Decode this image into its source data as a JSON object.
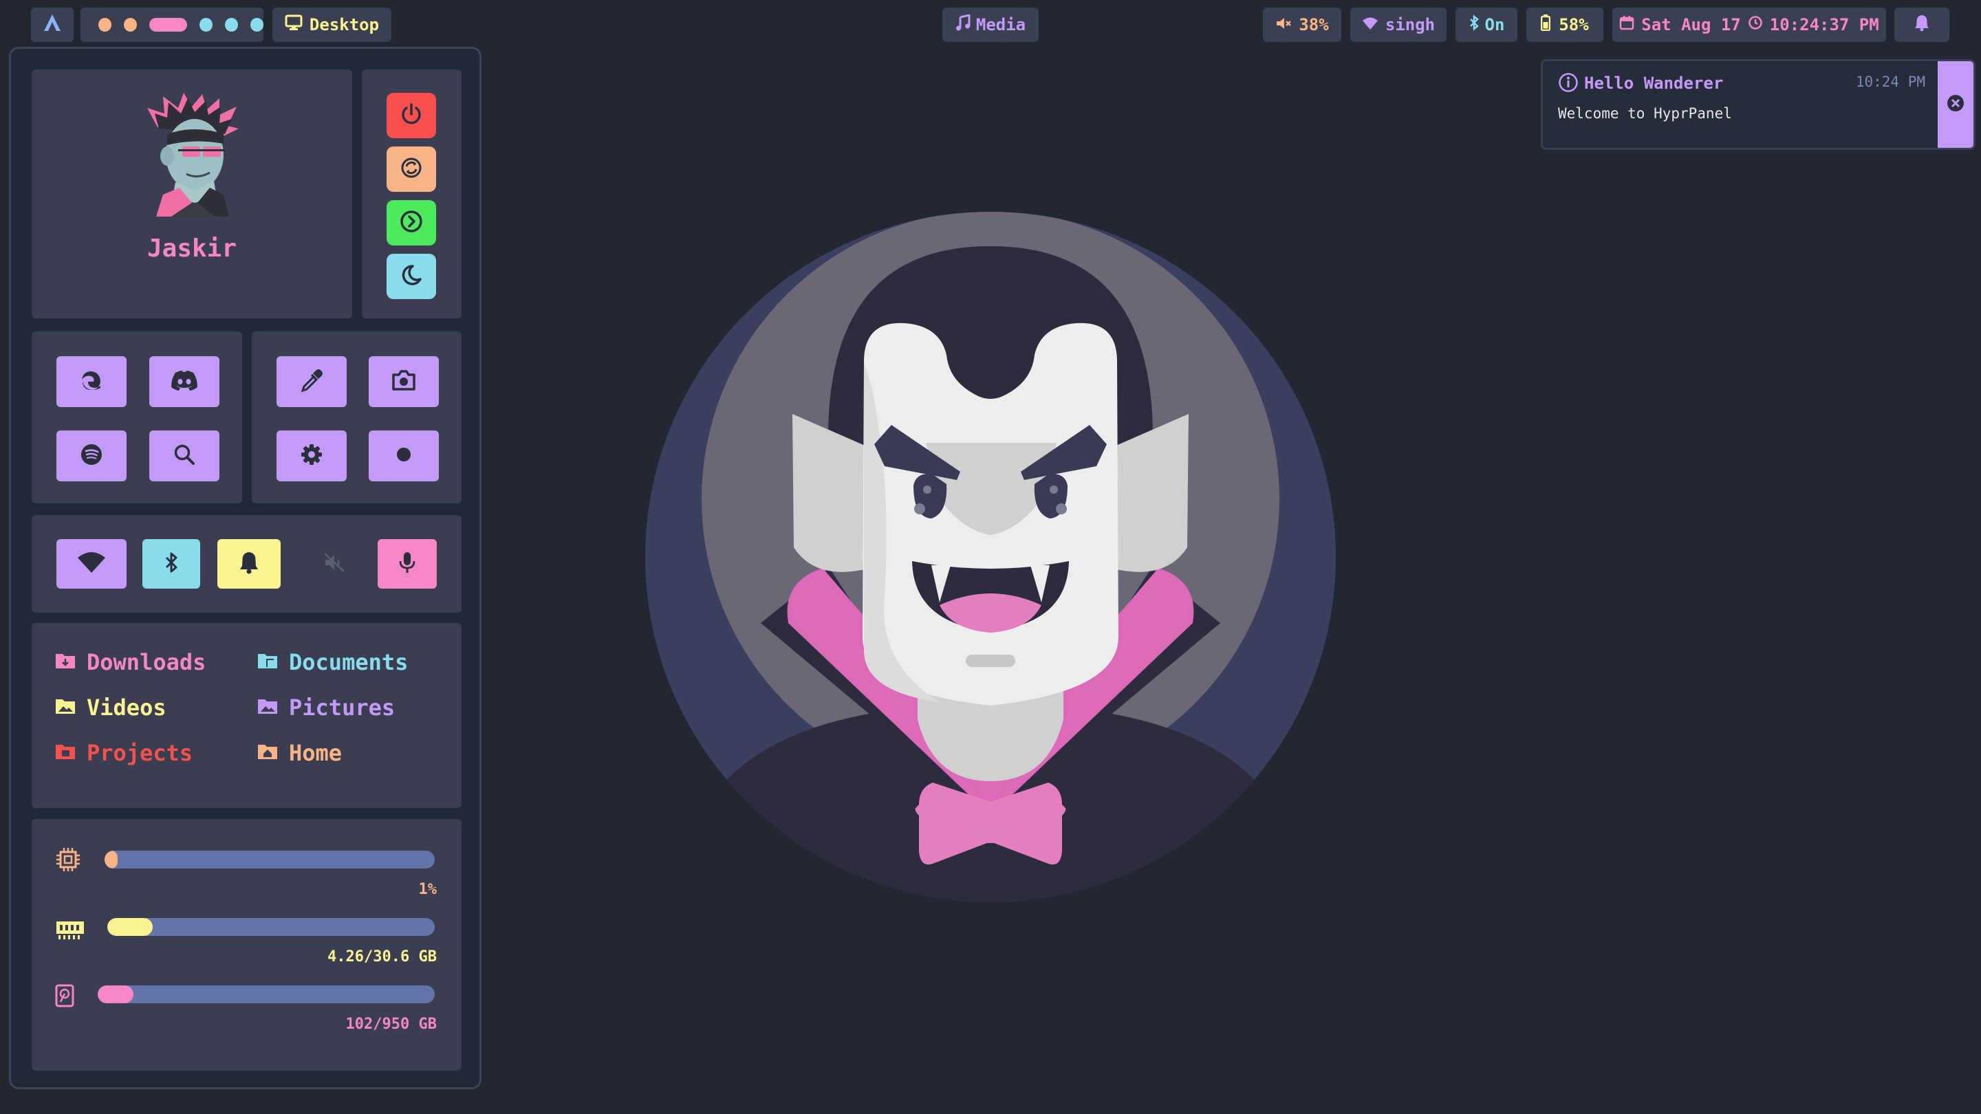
{
  "topbar": {
    "workspace_label": "Desktop",
    "media_label": "Media",
    "volume_value": "38%",
    "network_name": "singh",
    "bluetooth_status": "On",
    "battery_value": "58%",
    "date": "Sat Aug 17",
    "time": "10:24:37 PM",
    "workspace_dot_colors": [
      "#fab387",
      "#fab387",
      "#f38ba8",
      "#89dceb",
      "#89dceb",
      "#89dceb"
    ]
  },
  "profile": {
    "username": "Jaskir"
  },
  "power_buttons": [
    {
      "name": "shutdown",
      "icon": "power-icon",
      "color": "#f7504f"
    },
    {
      "name": "reboot",
      "icon": "refresh-icon",
      "color": "#fab387"
    },
    {
      "name": "logout",
      "icon": "logout-icon",
      "color": "#4dea5e"
    },
    {
      "name": "sleep",
      "icon": "moon-icon",
      "color": "#89dceb"
    }
  ],
  "shortcuts": {
    "left": [
      "edge-icon",
      "discord-icon",
      "spotify-icon",
      "search-icon"
    ],
    "right": [
      "color-picker-icon",
      "camera-icon",
      "settings-icon",
      "record-icon"
    ]
  },
  "toggles": [
    {
      "name": "wifi",
      "icon": "wifi-icon",
      "color": "#c39af8"
    },
    {
      "name": "bluetooth",
      "icon": "bluetooth-icon",
      "color": "#89dceb"
    },
    {
      "name": "notifications",
      "icon": "bell-icon",
      "color": "#f9f491"
    },
    {
      "name": "speaker",
      "icon": "speaker-muted-icon",
      "color": "transparent"
    },
    {
      "name": "microphone",
      "icon": "microphone-icon",
      "color": "#f587c4"
    }
  ],
  "directories": [
    {
      "label": "Downloads",
      "color": "#f587c4"
    },
    {
      "label": "Documents",
      "color": "#89dceb"
    },
    {
      "label": "Videos",
      "color": "#f9f491"
    },
    {
      "label": "Pictures",
      "color": "#c39af8"
    },
    {
      "label": "Projects",
      "color": "#f7504f"
    },
    {
      "label": "Home",
      "color": "#fab387"
    }
  ],
  "stats": {
    "cpu": {
      "label": "1%",
      "fraction": 0.01,
      "color": "#fab387"
    },
    "ram": {
      "label": "4.26/30.6 GB",
      "fraction": 0.139,
      "color": "#f9f491"
    },
    "disk": {
      "label": "102/950 GB",
      "fraction": 0.107,
      "color": "#f587c4"
    }
  },
  "notification": {
    "title": "Hello Wanderer",
    "time": "10:24 PM",
    "body": "Welcome to HyprPanel"
  },
  "colors": {
    "background": "#222733",
    "accent_purple": "#c39af8",
    "accent_pink": "#f587c4"
  }
}
